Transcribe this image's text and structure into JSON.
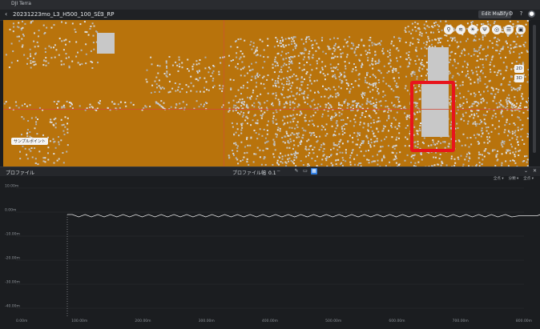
{
  "window": {
    "title": "DJI Terra"
  },
  "header": {
    "back_icon": "chevron-left-icon",
    "filename": "20231223mo_L3_H500_100_SL3_RP",
    "edit_icon": "pencil-icon",
    "modify_button": "Edit Modify",
    "icons": [
      "bell-icon",
      "settings-icon",
      "help-icon",
      "avatar"
    ]
  },
  "viewport": {
    "tools": [
      "pin-icon",
      "layers-icon",
      "bulb-icon",
      "antenna-icon",
      "compass-icon",
      "list-icon",
      "frame-icon"
    ],
    "view_buttons": [
      "2D",
      "3D"
    ],
    "tag": "サンプルポイント"
  },
  "profile": {
    "title": "プロファイル",
    "width_label": "プロファイル幅",
    "width_value": "0.1",
    "width_step": "−",
    "tools": [
      "pen-icon",
      "snapshot-icon",
      "grid-icon"
    ],
    "window_buttons": [
      "⌄",
      "✕"
    ],
    "filters": [
      "全点 ▾",
      "分類 ▾",
      "全点 ▾"
    ]
  },
  "chart_data": {
    "type": "line",
    "y_ticks": [
      "10.00m",
      "0.00m",
      "-10.00m",
      "-20.00m",
      "-30.00m",
      "-40.00m"
    ],
    "x_ticks": [
      "0.00m",
      "100.00m",
      "200.00m",
      "300.00m",
      "400.00m",
      "500.00m",
      "600.00m",
      "700.00m",
      "800.00m"
    ],
    "xlim": [
      0,
      800
    ],
    "ylim": [
      -44,
      12
    ],
    "colors": {
      "line": "#e8e8e8",
      "grid": "#2c2f33"
    },
    "series": [
      {
        "values_x": [
          0,
          8,
          18,
          28,
          38,
          48,
          58,
          68,
          78,
          88,
          98,
          108,
          118,
          128,
          138,
          148,
          158,
          168,
          178,
          188,
          198,
          208,
          218,
          228,
          238,
          248,
          258,
          268,
          278,
          288,
          298,
          308,
          318,
          328,
          338,
          348,
          358,
          368,
          378,
          388,
          398,
          408,
          418,
          428,
          438,
          448,
          458,
          468,
          478,
          488,
          498,
          508,
          518,
          528,
          538,
          548,
          558,
          568,
          578,
          588,
          598,
          608,
          618,
          628,
          638,
          648,
          658,
          668,
          678,
          690,
          700,
          712,
          740,
          745,
          750
        ],
        "values_y": [
          -1.0,
          -1.0,
          -2.0,
          -1.0,
          -2.0,
          -1.0,
          -2.0,
          -1.0,
          -2.0,
          -1.0,
          -2.0,
          -1.0,
          -2.0,
          -1.0,
          -2.0,
          -1.0,
          -2.0,
          -1.0,
          -2.0,
          -1.0,
          -2.0,
          -1.0,
          -2.0,
          -1.0,
          -2.0,
          -1.0,
          -2.0,
          -1.0,
          -2.0,
          -1.0,
          -2.0,
          -1.0,
          -2.0,
          -1.0,
          -2.0,
          -1.0,
          -2.0,
          -1.0,
          -2.0,
          -1.0,
          -2.0,
          -1.0,
          -2.0,
          -1.0,
          -2.0,
          -1.0,
          -2.0,
          -1.0,
          -2.0,
          -1.0,
          -2.0,
          -1.0,
          -2.0,
          -1.0,
          -2.0,
          -1.0,
          -2.0,
          -1.0,
          -2.0,
          -1.0,
          -2.0,
          -1.0,
          -2.0,
          -1.0,
          -2.0,
          -1.0,
          -2.0,
          -1.0,
          -2.0,
          -1.0,
          -2.0,
          -1.5,
          -1.5,
          -1.0,
          -1.0
        ]
      }
    ]
  }
}
